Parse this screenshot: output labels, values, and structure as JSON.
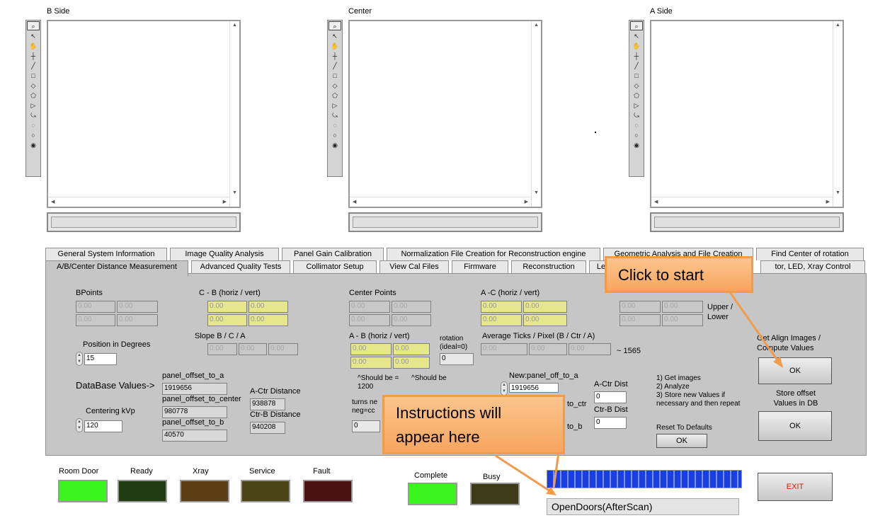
{
  "viewers": {
    "b": {
      "title": "B Side"
    },
    "center": {
      "title": "Center"
    },
    "a": {
      "title": "A Side"
    }
  },
  "tool_icons": [
    "zoom-icon",
    "pointer-icon",
    "pan-icon",
    "crosshair-icon",
    "line-icon",
    "rectangle-icon",
    "rotated-rectangle-icon",
    "polygon-icon",
    "freehand-region-icon",
    "freehand-line-icon",
    "annulus-icon",
    "oval-icon",
    "spiral-icon"
  ],
  "tool_glyphs": [
    "⌕",
    "↖",
    "✋",
    "┼",
    "╱",
    "□",
    "◇",
    "⬠",
    "▷",
    "⤿",
    "◌",
    "○",
    "◉"
  ],
  "tabs_back": [
    {
      "label": "General System Information"
    },
    {
      "label": "Image Quality Analysis"
    },
    {
      "label": "Panel Gain Calibration"
    },
    {
      "label": "Normalization File Creation for Reconstruction engine"
    },
    {
      "label": "Geometric Analysis and File Creation"
    },
    {
      "label": "Find Center of rotation"
    }
  ],
  "tabs_front": [
    {
      "label": "A/B/Center Distance Measurement"
    },
    {
      "label": "Advanced Quality Tests"
    },
    {
      "label": "Collimator Setup"
    },
    {
      "label": "View Cal Files"
    },
    {
      "label": "Firmware"
    },
    {
      "label": "Reconstruction"
    },
    {
      "label": "Le"
    },
    {
      "label": "tor, LED, Xray Control"
    }
  ],
  "panel": {
    "bpoints_label": "BPoints",
    "bpoints": [
      "0.00",
      "0.00",
      "0.00",
      "0.00"
    ],
    "cb_label": "C - B (horiz / vert)",
    "cb": [
      "0.00",
      "0.00",
      "0.00",
      "0.00"
    ],
    "center_points_label": "Center Points",
    "center_points": [
      "0.00",
      "0.00",
      "0.00",
      "0.00"
    ],
    "ac_label": "A -C (horiz / vert)",
    "ac": [
      "0.00",
      "0.00",
      "0.00",
      "0.00"
    ],
    "apoints": [
      "0.00",
      "0.00",
      "0.00",
      "0.00"
    ],
    "upper_lower_label": "Upper / Lower",
    "slope_label": "Slope B / C / A",
    "slope": [
      "0.00",
      "0.00",
      "0.00"
    ],
    "ab_label": "A - B (horiz / vert)",
    "ab": [
      "0.00",
      "0.00",
      "0.00",
      "0.00"
    ],
    "rotation_label": "rotation (ideal=0)",
    "rotation_value": "0",
    "avg_ticks_label": "Average Ticks / Pixel (B / Ctr / A)",
    "avg_ticks": [
      "0.00",
      "0.00",
      "0.00"
    ],
    "approx_label": "~ 1565",
    "position_label": "Position in Degrees",
    "position_value": "15",
    "db_values_label": "DataBase Values->",
    "offset_a_label": "panel_offset_to_a",
    "offset_a_value": "1919656",
    "offset_center_label": "panel_offset_to_center",
    "offset_center_value": "980778",
    "offset_b_label": "panel_offset_to_b",
    "offset_b_value": "40570",
    "a_ctr_label": "A-Ctr Distance",
    "a_ctr_value": "938878",
    "ctr_b_label": "Ctr-B Distance",
    "ctr_b_value": "940208",
    "centering_label": "Centering kVp",
    "centering_value": "120",
    "should_be_1": "^Should be = 1200",
    "should_be_2": "^Should be",
    "turns_label": "turns ne neg=cc",
    "turns_value": "0",
    "new_offset_a_label": "New:panel_off_to_a",
    "new_offset_a_value": "1919656",
    "new_ctr_label": "to_ctr",
    "new_b_label": "to_b",
    "new_a_ctr_label": "A-Ctr Dist",
    "new_a_ctr_value": "0",
    "new_ctr_b_label": "Ctr-B Dist",
    "new_ctr_b_value": "0",
    "steps": "1) Get images\n2) Analyze\n3) Store new Values if necessary and then repeat",
    "reset_label": "Reset To Defaults",
    "reset_button": "OK",
    "get_align_label": "Get Align Images / Compute Values",
    "get_align_button": "OK",
    "store_label": "Store offset Values in DB",
    "store_button": "OK"
  },
  "indicators": {
    "room_door": {
      "label": "Room Door",
      "color": "#3cf51e"
    },
    "ready": {
      "label": "Ready",
      "color": "#1f3d10"
    },
    "xray": {
      "label": "Xray",
      "color": "#5e3f15"
    },
    "service": {
      "label": "Service",
      "color": "#4a4414"
    },
    "fault": {
      "label": "Fault",
      "color": "#4a1212"
    },
    "complete": {
      "label": "Complete",
      "color": "#3cf51e"
    },
    "busy": {
      "label": "Busy",
      "color": "#3d3a18"
    }
  },
  "status_text": "OpenDoors(AfterScan)",
  "exit_label": "EXIT",
  "callouts": {
    "start": "Click to start",
    "instructions": "Instructions will appear here"
  },
  "colors": {
    "accent_orange": "#f19b4c",
    "progress_blue": "#1a3fe0",
    "exit_red": "#cc2200"
  }
}
